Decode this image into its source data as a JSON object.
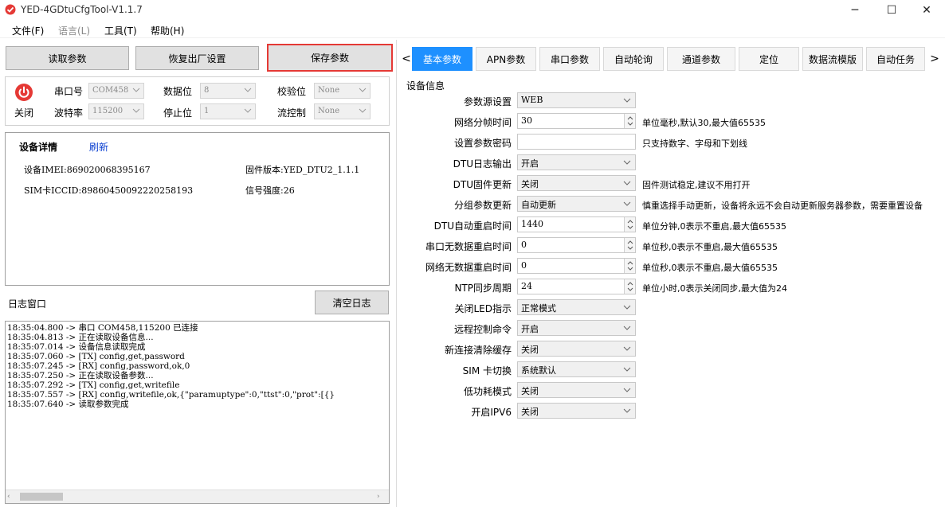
{
  "window": {
    "title": "YED-4GDtuCfgTool-V1.1.7",
    "minimize": "─",
    "maximize": "☐",
    "close": "✕"
  },
  "menu": [
    "文件(F)",
    "语言(L)",
    "工具(T)",
    "帮助(H)"
  ],
  "buttons": {
    "read": "读取参数",
    "restore": "恢复出厂设置",
    "save": "保存参数",
    "clear_log": "清空日志"
  },
  "serial": {
    "power_label": "关闭",
    "port_label": "串口号",
    "port_value": "COM458",
    "baud_label": "波特率",
    "baud_value": "115200",
    "databits_label": "数据位",
    "databits_value": "8",
    "stopbits_label": "停止位",
    "stopbits_value": "1",
    "parity_label": "校验位",
    "parity_value": "None",
    "flow_label": "流控制",
    "flow_value": "None"
  },
  "device": {
    "title": "设备详情",
    "refresh": "刷新",
    "imei": "设备IMEI:869020068395167",
    "firmware": "固件版本:YED_DTU2_1.1.1",
    "iccid": "SIM卡ICCID:89860450092220258193",
    "signal": "信号强度:26"
  },
  "log": {
    "title": "日志窗口",
    "lines": [
      "18:35:04.800 -> 串口 COM458,115200 已连接",
      "18:35:04.813 -> 正在读取设备信息...",
      "18:35:07.014 -> 设备信息读取完成",
      "18:35:07.060 -> [TX] config,get,password",
      "18:35:07.245 -> [RX] config,password,ok,0",
      "18:35:07.250 -> 正在读取设备参数...",
      "18:35:07.292 -> [TX] config,get,writefile",
      "18:35:07.557 -> [RX] config,writefile,ok,{\"paramuptype\":0,\"ttst\":0,\"prot\":[{}",
      "18:35:07.640 -> 读取参数完成"
    ]
  },
  "tabs": [
    "基本参数",
    "APN参数",
    "串口参数",
    "自动轮询",
    "通道参数",
    "定位",
    "数据流模版",
    "自动任务"
  ],
  "tab_prev": "<",
  "tab_next": ">",
  "settings": {
    "group_title": "设备信息",
    "fields": [
      {
        "label": "参数源设置",
        "value": "WEB",
        "kind": "select",
        "note": ""
      },
      {
        "label": "网络分帧时间",
        "value": "30",
        "kind": "spin",
        "note": "单位毫秒,默认30,最大值65535"
      },
      {
        "label": "设置参数密码",
        "value": "",
        "kind": "text",
        "note": "只支持数字、字母和下划线"
      },
      {
        "label": "DTU日志输出",
        "value": "开启",
        "kind": "select",
        "note": ""
      },
      {
        "label": "DTU固件更新",
        "value": "关闭",
        "kind": "select",
        "note": "固件测试稳定,建议不用打开"
      },
      {
        "label": "分组参数更新",
        "value": "自动更新",
        "kind": "select",
        "note": "慎重选择手动更新，设备将永远不会自动更新服务器参数，需要重置设备"
      },
      {
        "label": "DTU自动重启时间",
        "value": "1440",
        "kind": "spin",
        "note": "单位分钟,0表示不重启,最大值65535"
      },
      {
        "label": "串口无数据重启时间",
        "value": "0",
        "kind": "spin",
        "note": "单位秒,0表示不重启,最大值65535"
      },
      {
        "label": "网络无数据重启时间",
        "value": "0",
        "kind": "spin",
        "note": "单位秒,0表示不重启,最大值65535"
      },
      {
        "label": "NTP同步周期",
        "value": "24",
        "kind": "spin",
        "note": "单位小时,0表示关闭同步,最大值为24"
      },
      {
        "label": "关闭LED指示",
        "value": "正常模式",
        "kind": "select",
        "note": ""
      },
      {
        "label": "远程控制命令",
        "value": "开启",
        "kind": "select",
        "note": ""
      },
      {
        "label": "新连接清除缓存",
        "value": "关闭",
        "kind": "select",
        "note": ""
      },
      {
        "label": "SIM 卡切换",
        "value": "系统默认",
        "kind": "select",
        "note": ""
      },
      {
        "label": "低功耗模式",
        "value": "关闭",
        "kind": "select",
        "note": ""
      },
      {
        "label": "开启IPV6",
        "value": "关闭",
        "kind": "select",
        "note": ""
      }
    ]
  },
  "colors": {
    "accent": "#1E90FF",
    "highlight_border": "#E53935",
    "power": "#E53935"
  }
}
